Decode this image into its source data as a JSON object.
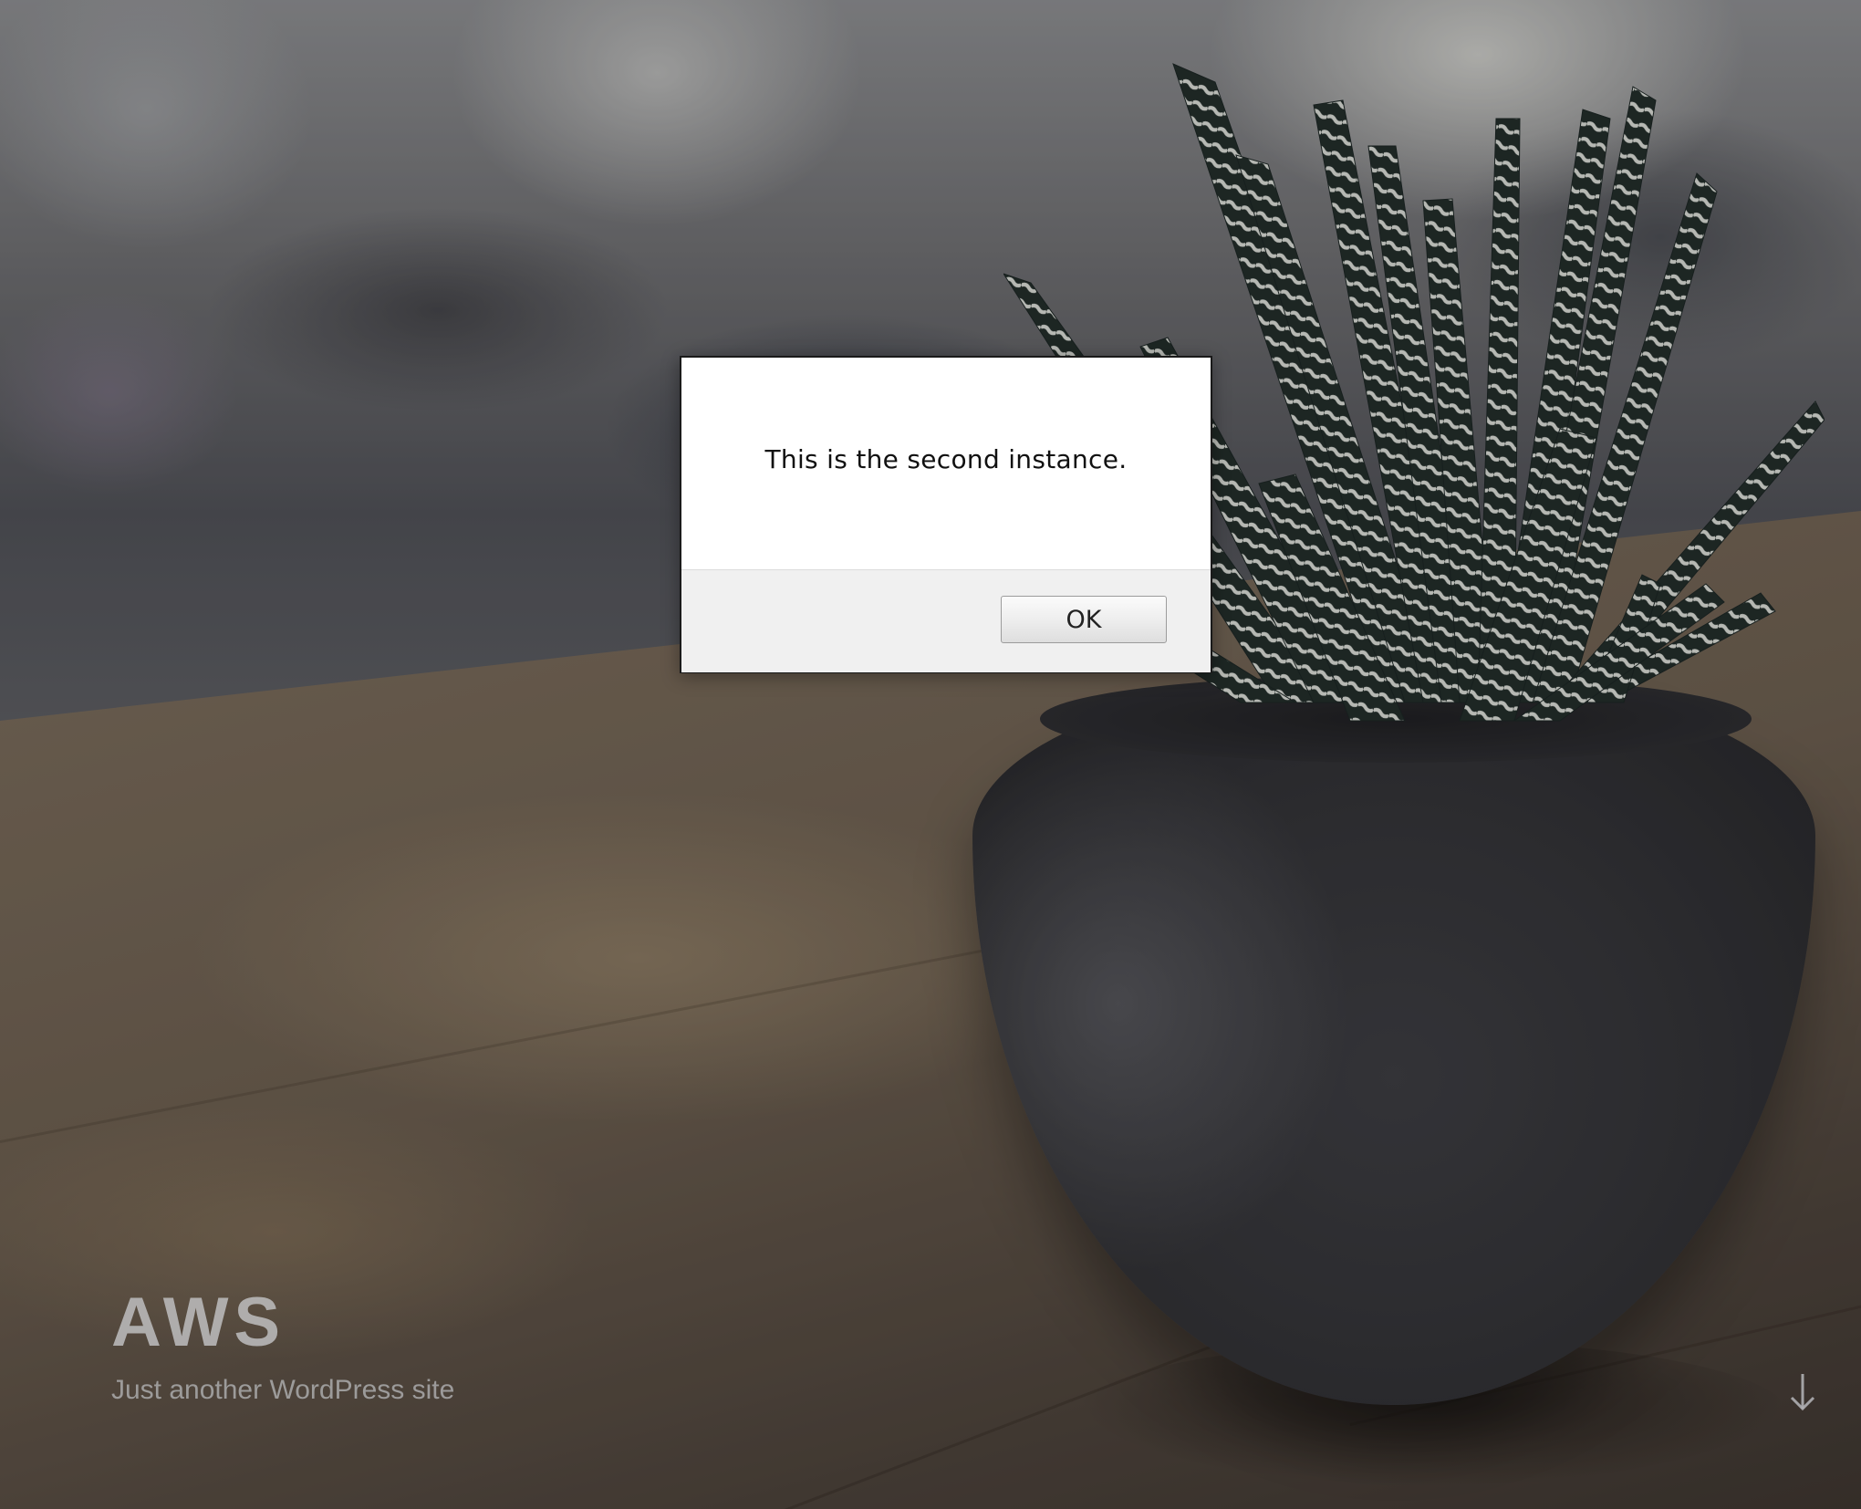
{
  "site": {
    "title": "AWS",
    "tagline": "Just another WordPress site"
  },
  "dialog": {
    "message": "This is the second instance.",
    "ok_label": "OK"
  },
  "icons": {
    "scroll_down": "arrow-down-icon"
  },
  "colors": {
    "dialog_background": "#ffffff",
    "dialog_footer": "#f0f0f0",
    "dialog_border": "#1a1a1a",
    "site_title": "#bebebe",
    "pot": "#2f2f33"
  }
}
